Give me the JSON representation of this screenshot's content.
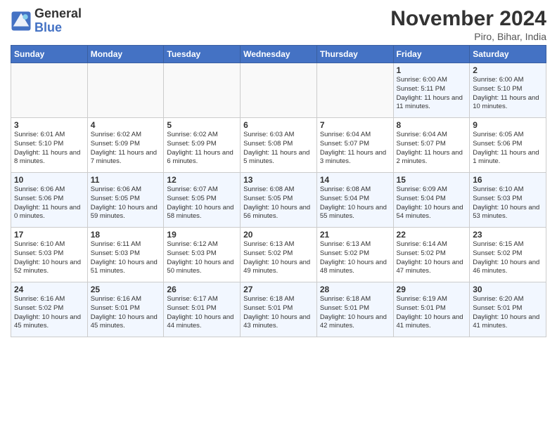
{
  "header": {
    "logo_line1": "General",
    "logo_line2": "Blue",
    "month_title": "November 2024",
    "location": "Piro, Bihar, India"
  },
  "weekdays": [
    "Sunday",
    "Monday",
    "Tuesday",
    "Wednesday",
    "Thursday",
    "Friday",
    "Saturday"
  ],
  "weeks": [
    [
      {
        "day": "",
        "info": ""
      },
      {
        "day": "",
        "info": ""
      },
      {
        "day": "",
        "info": ""
      },
      {
        "day": "",
        "info": ""
      },
      {
        "day": "",
        "info": ""
      },
      {
        "day": "1",
        "info": "Sunrise: 6:00 AM\nSunset: 5:11 PM\nDaylight: 11 hours and 11 minutes."
      },
      {
        "day": "2",
        "info": "Sunrise: 6:00 AM\nSunset: 5:10 PM\nDaylight: 11 hours and 10 minutes."
      }
    ],
    [
      {
        "day": "3",
        "info": "Sunrise: 6:01 AM\nSunset: 5:10 PM\nDaylight: 11 hours and 8 minutes."
      },
      {
        "day": "4",
        "info": "Sunrise: 6:02 AM\nSunset: 5:09 PM\nDaylight: 11 hours and 7 minutes."
      },
      {
        "day": "5",
        "info": "Sunrise: 6:02 AM\nSunset: 5:09 PM\nDaylight: 11 hours and 6 minutes."
      },
      {
        "day": "6",
        "info": "Sunrise: 6:03 AM\nSunset: 5:08 PM\nDaylight: 11 hours and 5 minutes."
      },
      {
        "day": "7",
        "info": "Sunrise: 6:04 AM\nSunset: 5:07 PM\nDaylight: 11 hours and 3 minutes."
      },
      {
        "day": "8",
        "info": "Sunrise: 6:04 AM\nSunset: 5:07 PM\nDaylight: 11 hours and 2 minutes."
      },
      {
        "day": "9",
        "info": "Sunrise: 6:05 AM\nSunset: 5:06 PM\nDaylight: 11 hours and 1 minute."
      }
    ],
    [
      {
        "day": "10",
        "info": "Sunrise: 6:06 AM\nSunset: 5:06 PM\nDaylight: 11 hours and 0 minutes."
      },
      {
        "day": "11",
        "info": "Sunrise: 6:06 AM\nSunset: 5:05 PM\nDaylight: 10 hours and 59 minutes."
      },
      {
        "day": "12",
        "info": "Sunrise: 6:07 AM\nSunset: 5:05 PM\nDaylight: 10 hours and 58 minutes."
      },
      {
        "day": "13",
        "info": "Sunrise: 6:08 AM\nSunset: 5:05 PM\nDaylight: 10 hours and 56 minutes."
      },
      {
        "day": "14",
        "info": "Sunrise: 6:08 AM\nSunset: 5:04 PM\nDaylight: 10 hours and 55 minutes."
      },
      {
        "day": "15",
        "info": "Sunrise: 6:09 AM\nSunset: 5:04 PM\nDaylight: 10 hours and 54 minutes."
      },
      {
        "day": "16",
        "info": "Sunrise: 6:10 AM\nSunset: 5:03 PM\nDaylight: 10 hours and 53 minutes."
      }
    ],
    [
      {
        "day": "17",
        "info": "Sunrise: 6:10 AM\nSunset: 5:03 PM\nDaylight: 10 hours and 52 minutes."
      },
      {
        "day": "18",
        "info": "Sunrise: 6:11 AM\nSunset: 5:03 PM\nDaylight: 10 hours and 51 minutes."
      },
      {
        "day": "19",
        "info": "Sunrise: 6:12 AM\nSunset: 5:03 PM\nDaylight: 10 hours and 50 minutes."
      },
      {
        "day": "20",
        "info": "Sunrise: 6:13 AM\nSunset: 5:02 PM\nDaylight: 10 hours and 49 minutes."
      },
      {
        "day": "21",
        "info": "Sunrise: 6:13 AM\nSunset: 5:02 PM\nDaylight: 10 hours and 48 minutes."
      },
      {
        "day": "22",
        "info": "Sunrise: 6:14 AM\nSunset: 5:02 PM\nDaylight: 10 hours and 47 minutes."
      },
      {
        "day": "23",
        "info": "Sunrise: 6:15 AM\nSunset: 5:02 PM\nDaylight: 10 hours and 46 minutes."
      }
    ],
    [
      {
        "day": "24",
        "info": "Sunrise: 6:16 AM\nSunset: 5:02 PM\nDaylight: 10 hours and 45 minutes."
      },
      {
        "day": "25",
        "info": "Sunrise: 6:16 AM\nSunset: 5:01 PM\nDaylight: 10 hours and 45 minutes."
      },
      {
        "day": "26",
        "info": "Sunrise: 6:17 AM\nSunset: 5:01 PM\nDaylight: 10 hours and 44 minutes."
      },
      {
        "day": "27",
        "info": "Sunrise: 6:18 AM\nSunset: 5:01 PM\nDaylight: 10 hours and 43 minutes."
      },
      {
        "day": "28",
        "info": "Sunrise: 6:18 AM\nSunset: 5:01 PM\nDaylight: 10 hours and 42 minutes."
      },
      {
        "day": "29",
        "info": "Sunrise: 6:19 AM\nSunset: 5:01 PM\nDaylight: 10 hours and 41 minutes."
      },
      {
        "day": "30",
        "info": "Sunrise: 6:20 AM\nSunset: 5:01 PM\nDaylight: 10 hours and 41 minutes."
      }
    ]
  ]
}
